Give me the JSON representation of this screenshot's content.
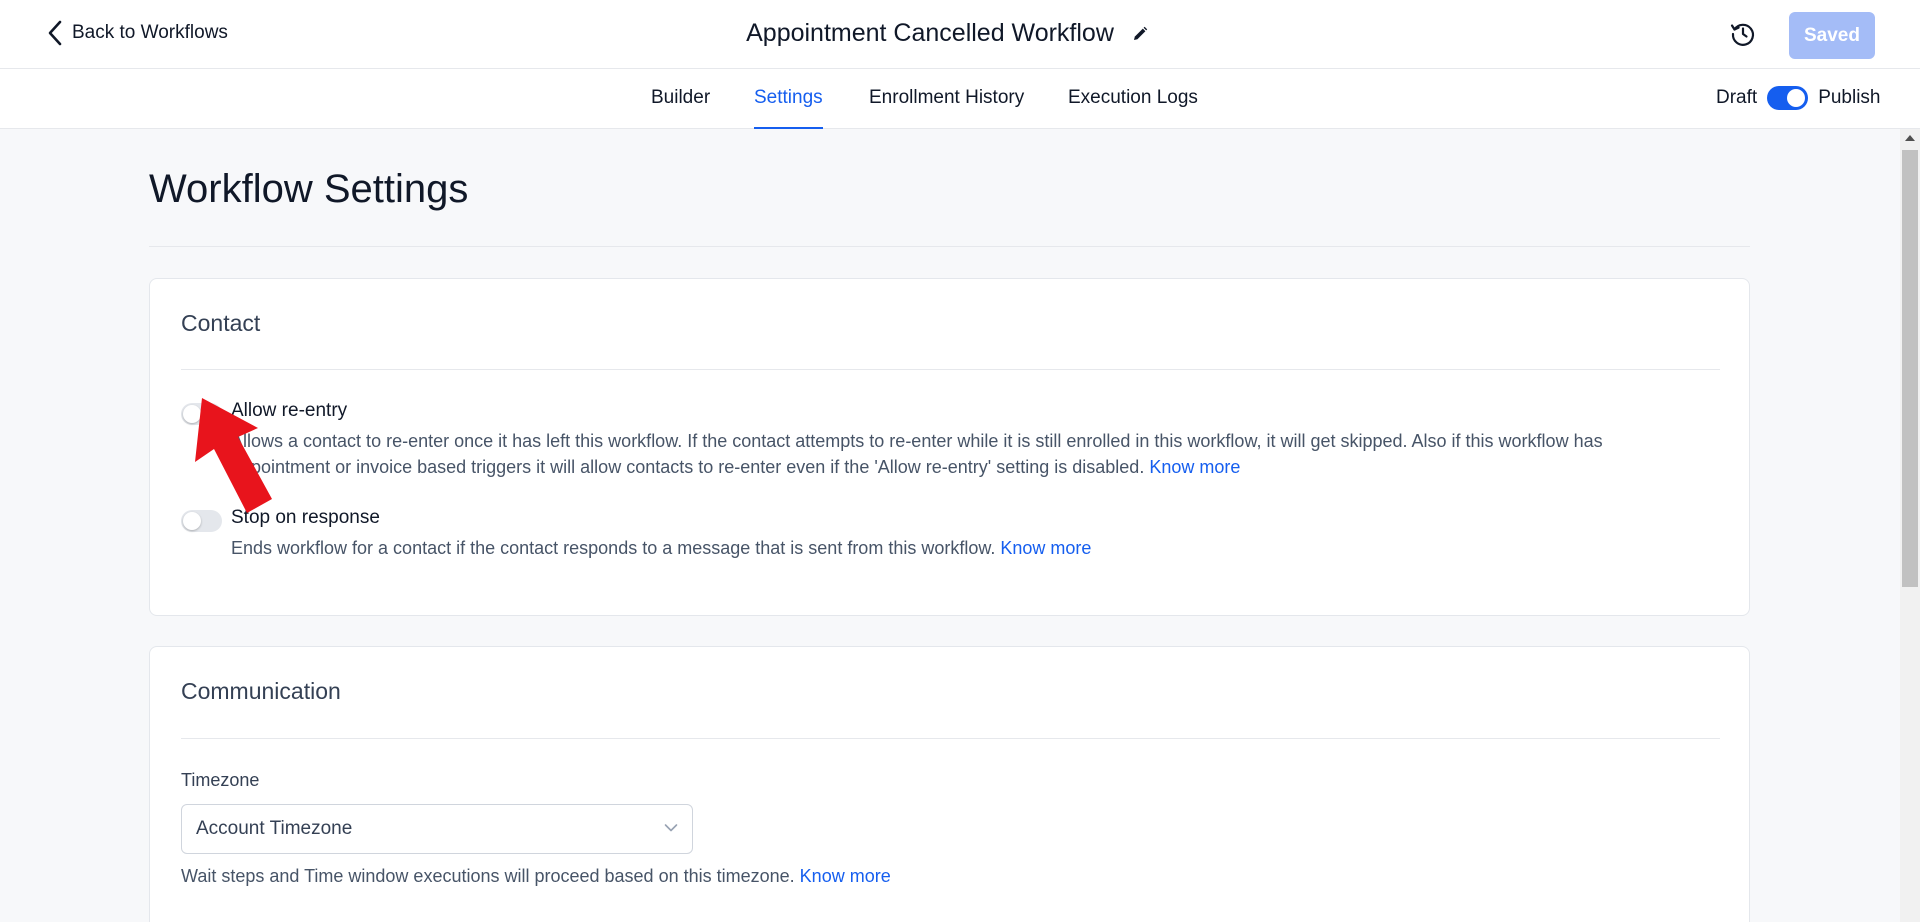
{
  "header": {
    "back_label": "Back to Workflows",
    "workflow_title": "Appointment Cancelled Workflow",
    "saved_label": "Saved"
  },
  "tabs": [
    {
      "label": "Builder"
    },
    {
      "label": "Settings",
      "active": true
    },
    {
      "label": "Enrollment History"
    },
    {
      "label": "Execution Logs"
    }
  ],
  "publish_toggle": {
    "draft_label": "Draft",
    "publish_label": "Publish",
    "state": "on"
  },
  "page": {
    "title": "Workflow Settings"
  },
  "contact_card": {
    "title": "Contact",
    "settings": [
      {
        "label": "Allow re-entry",
        "state": "off",
        "description": "Allows a contact to re-enter once it has left this workflow. If the contact attempts to re-enter while it is still enrolled in this workflow, it will get skipped. Also if this workflow has appointment or invoice based triggers it will allow contacts to re-enter even if the 'Allow re-entry' setting is disabled.",
        "link": "Know more"
      },
      {
        "label": "Stop on response",
        "state": "off",
        "description": "Ends workflow for a contact if the contact responds to a message that is sent from this workflow.",
        "link": "Know more"
      }
    ]
  },
  "communication_card": {
    "title": "Communication",
    "timezone_label": "Timezone",
    "timezone_value": "Account Timezone",
    "timezone_help": "Wait steps and Time window executions will proceed based on this timezone.",
    "link": "Know more"
  },
  "icons": [
    "chevron-left-icon",
    "pencil-icon",
    "history-icon",
    "chevron-down-icon",
    "pointer-arrow-icon"
  ],
  "colors": {
    "accent": "#155eef",
    "saved_button": "#a4bcf7",
    "annotation_arrow": "#e8141c"
  }
}
